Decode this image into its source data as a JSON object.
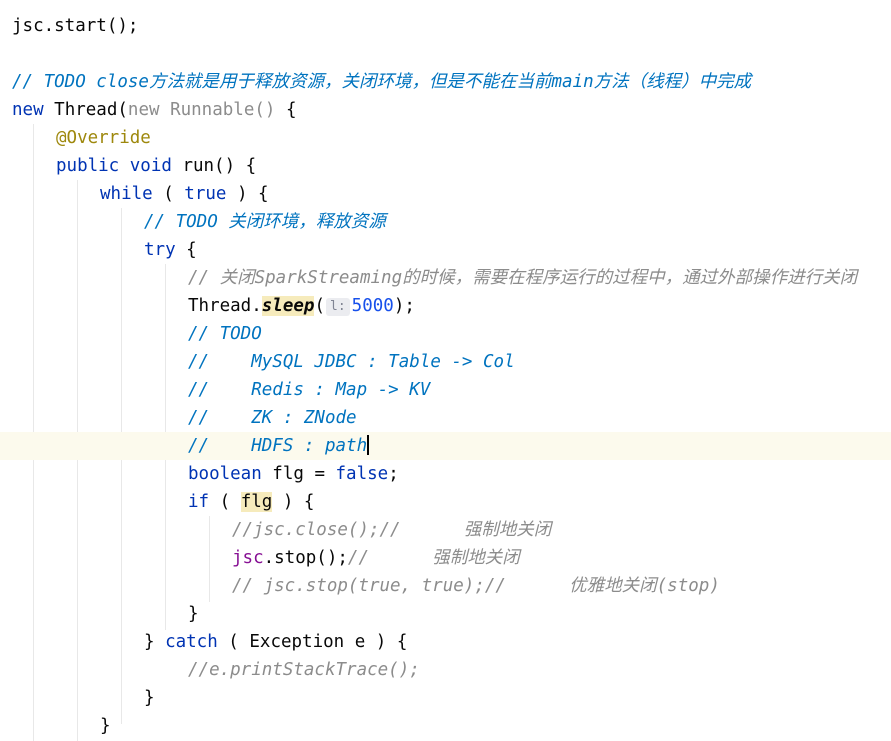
{
  "lines": {
    "l1_code": "jsc.start();",
    "l3_comment": "// TODO close方法就是用于释放资源，关闭环境，但是不能在当前main方法（线程）中完成",
    "l4_new1": "new ",
    "l4_thread": "Thread(",
    "l4_new2": "new ",
    "l4_runnable": "Runnable()",
    "l4_brace": " {",
    "l5_ann": "@Override",
    "l6_public": "public void ",
    "l6_run": "run() {",
    "l7_while": "while ",
    "l7_paren": "( ",
    "l7_true": "true",
    "l7_end": " ) {",
    "l8_comment": "// TODO 关闭环境，释放资源",
    "l9_try": "try ",
    "l9_brace": "{",
    "l10_comment": "// 关闭SparkStreaming的时候，需要在程序运行的过程中，通过外部操作进行关闭",
    "l11_thread": "Thread.",
    "l11_sleep": "sleep",
    "l11_open": "(",
    "l11_hint": "l:",
    "l11_num": "5000",
    "l11_close": ");",
    "l12_comment": "// TODO",
    "l13_comment": "//    MySQL JDBC : Table -> Col",
    "l14_comment": "//    Redis : Map -> KV",
    "l15_comment": "//    ZK : ZNode",
    "l16_comment": "//    HDFS : path",
    "l17_boolean": "boolean ",
    "l17_mid": "flg = ",
    "l17_false": "false",
    "l17_semi": ";",
    "l18_if": "if ",
    "l18_open": "( ",
    "l18_flg": "flg",
    "l18_close": " ) {",
    "l19_comment": "//jsc.close();//      强制地关闭",
    "l20_jsc": "jsc",
    "l20_stop": ".stop();",
    "l20_comment": "//      强制地关闭",
    "l21_comment": "// jsc.stop(true, true);//      优雅地关闭(stop)",
    "l22_brace": "}",
    "l23_brace": "} ",
    "l23_catch": "catch ",
    "l23_rest": "( Exception e ) {",
    "l24_comment": "//e.printStackTrace();",
    "l25_brace": "}",
    "l26_brace": "}"
  },
  "colors": {
    "keyword": "#0033b3",
    "comment": "#8c8c8c",
    "todo": "#0073bf",
    "annotation": "#9e880d",
    "number": "#1750eb",
    "field": "#871094",
    "current_line": "#fcfaed",
    "highlight": "#f6ebbc"
  }
}
